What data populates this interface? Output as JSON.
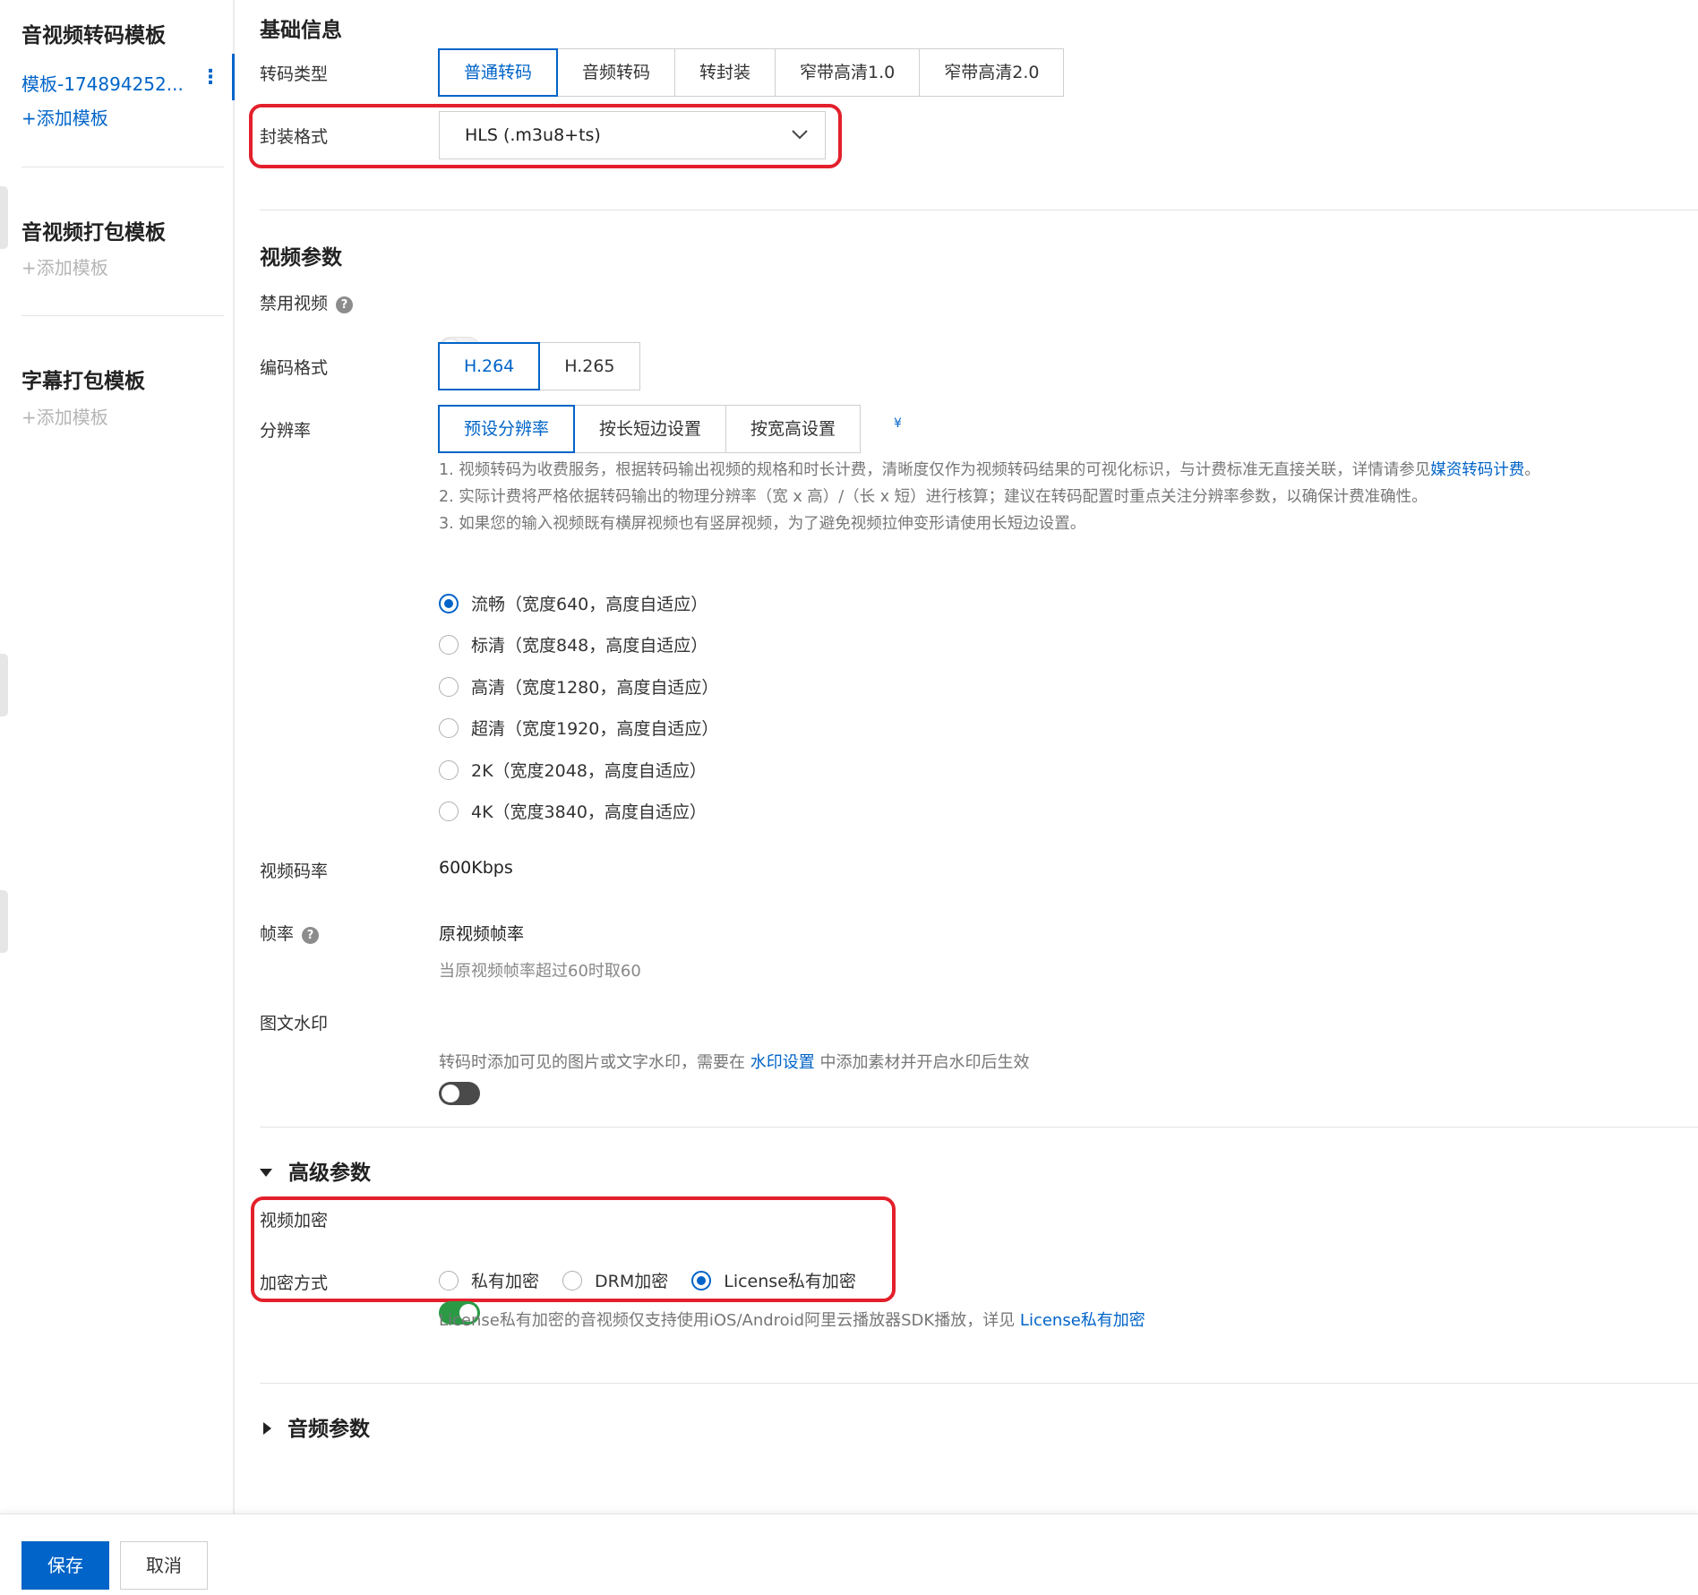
{
  "sidebar": {
    "transcode_title": "音视频转码模板",
    "template_item": "模板-174894252...",
    "more_icon": "⋮",
    "add_template_active": "+添加模板",
    "package_title": "音视频打包模板",
    "add_template_package": "+添加模板",
    "subtitle_title": "字幕打包模板",
    "add_template_subtitle": "+添加模板"
  },
  "basic": {
    "title": "基础信息",
    "type_label": "转码类型",
    "types": [
      "普通转码",
      "音频转码",
      "转封装",
      "窄带高清1.0",
      "窄带高清2.0"
    ],
    "selected_type": "普通转码",
    "format_label": "封装格式",
    "format_value": "HLS (.m3u8+ts)"
  },
  "video": {
    "title": "视频参数",
    "disable_label": "禁用视频",
    "help_glyph": "?",
    "codec_label": "编码格式",
    "codecs": [
      "H.264",
      "H.265"
    ],
    "resolution_label": "分辨率",
    "resolution_modes": [
      "预设分辨率",
      "按长短边设置",
      "按宽高设置"
    ],
    "yen_glyph": "¥",
    "note1_prefix": "1. 视频转码为收费服务，根据转码输出视频的规格和时长计费，清晰度仅作为视频转码结果的可视化标识，与计费标准无直接关联，详情请参见",
    "note1_link": "媒资转码计费",
    "note1_suffix": "。",
    "note2": "2. 实际计费将严格依据转码输出的物理分辨率（宽 x 高）/（长 x 短）进行核算；建议在转码配置时重点关注分辨率参数，以确保计费准确性。",
    "note3": "3. 如果您的输入视频既有横屏视频也有竖屏视频，为了避免视频拉伸变形请使用长短边设置。",
    "presets": [
      "流畅（宽度640，高度自适应）",
      "标清（宽度848，高度自适应）",
      "高清（宽度1280，高度自适应）",
      "超清（宽度1920，高度自适应）",
      "2K（宽度2048，高度自适应）",
      "4K（宽度3840，高度自适应）"
    ],
    "selected_preset_index": 0,
    "bitrate_label": "视频码率",
    "bitrate_value": "600Kbps",
    "framerate_label": "帧率",
    "framerate_value": "原视频帧率",
    "framerate_hint": "当原视频帧率超过60时取60",
    "watermark_label": "图文水印",
    "watermark_hint_prefix": "转码时添加可见的图片或文字水印，需要在 ",
    "watermark_hint_link": "水印设置",
    "watermark_hint_suffix": " 中添加素材并开启水印后生效"
  },
  "advanced": {
    "title": "高级参数",
    "encrypt_label": "视频加密",
    "encrypt_enabled": true,
    "method_label": "加密方式",
    "methods": [
      "私有加密",
      "DRM加密",
      "License私有加密"
    ],
    "selected_method_index": 2,
    "hint_prefix": "License私有加密的音视频仅支持使用iOS/Android阿里云播放器SDK播放，详见 ",
    "hint_link": "License私有加密"
  },
  "audio": {
    "title": "音频参数"
  },
  "footer": {
    "save_label": "保存",
    "cancel_label": "取消"
  },
  "colors": {
    "accent": "#0064c8",
    "highlight_box": "#e3202b",
    "toggle_on": "#2a9a45"
  }
}
